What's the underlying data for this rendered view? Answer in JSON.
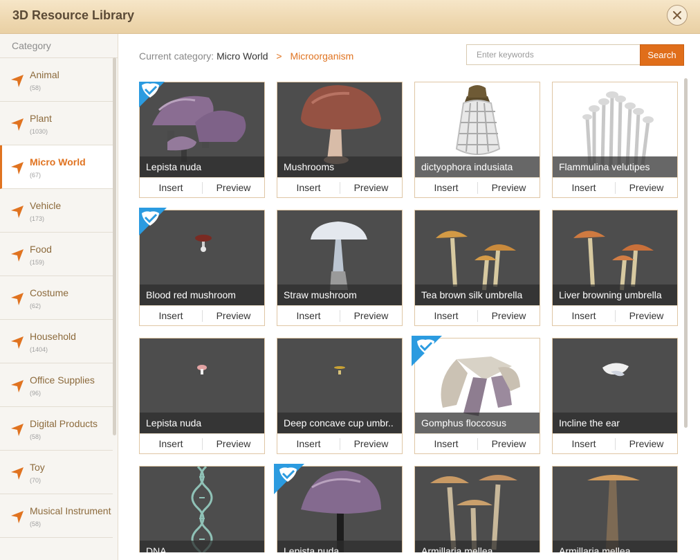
{
  "window": {
    "title": "3D Resource Library"
  },
  "sidebar": {
    "heading": "Category",
    "items": [
      {
        "label": "Animal",
        "count": "(58)",
        "active": false
      },
      {
        "label": "Plant",
        "count": "(1030)",
        "active": false
      },
      {
        "label": "Micro World",
        "count": "(67)",
        "active": true
      },
      {
        "label": "Vehicle",
        "count": "(173)",
        "active": false
      },
      {
        "label": "Food",
        "count": "(159)",
        "active": false
      },
      {
        "label": "Costume",
        "count": "(62)",
        "active": false
      },
      {
        "label": "Household",
        "count": "(1404)",
        "active": false
      },
      {
        "label": "Office Supplies",
        "count": "(96)",
        "active": false
      },
      {
        "label": "Digital Products",
        "count": "(58)",
        "active": false
      },
      {
        "label": "Toy",
        "count": "(70)",
        "active": false
      },
      {
        "label": "Musical Instrument",
        "count": "(58)",
        "active": false
      }
    ]
  },
  "breadcrumb": {
    "prefix": "Current category:",
    "level1": "Micro World",
    "separator": ">",
    "level2": "Microorganism"
  },
  "search": {
    "placeholder": "Enter keywords",
    "value": "",
    "button_label": "Search"
  },
  "card_actions": {
    "insert": "Insert",
    "preview": "Preview"
  },
  "colors": {
    "accent": "#e07320",
    "search_button": "#e06e1a",
    "card_border": "#dfc6a4",
    "thumb_bg": "#4d4d4d",
    "badge": "#2b9be0"
  },
  "cards": [
    {
      "name": "Lepista nuda",
      "badge": true,
      "icon": "purple-mushroom-cluster-icon",
      "light": false
    },
    {
      "name": "Mushrooms",
      "badge": false,
      "icon": "brown-mushroom-icon",
      "light": false
    },
    {
      "name": "dictyophora indusiata",
      "badge": false,
      "icon": "veiled-lady-mushroom-icon",
      "light": true
    },
    {
      "name": "Flammulina velutipes",
      "badge": false,
      "icon": "enoki-mushroom-icon",
      "light": true
    },
    {
      "name": "Blood red mushroom",
      "badge": true,
      "icon": "small-red-mushroom-icon",
      "light": false
    },
    {
      "name": "Straw mushroom",
      "badge": false,
      "icon": "white-mushroom-icon",
      "light": false
    },
    {
      "name": "Tea brown silk umbrella",
      "badge": false,
      "icon": "tan-mushroom-cluster-icon",
      "light": false
    },
    {
      "name": "Liver browning umbrella",
      "badge": false,
      "icon": "orange-mushroom-cluster-icon",
      "light": false
    },
    {
      "name": "Lepista nuda",
      "badge": false,
      "icon": "tiny-pink-mushroom-icon",
      "light": false
    },
    {
      "name": "Deep concave cup umbr..",
      "badge": false,
      "icon": "tiny-yellow-mushroom-icon",
      "light": false
    },
    {
      "name": "Gomphus floccosus",
      "badge": true,
      "icon": "gomphus-mushroom-icon",
      "light": true
    },
    {
      "name": "Incline the ear",
      "badge": false,
      "icon": "white-ear-fungus-icon",
      "light": false
    },
    {
      "name": "DNA",
      "badge": false,
      "icon": "dna-helix-icon",
      "light": false
    },
    {
      "name": "Lepista nuda",
      "badge": true,
      "icon": "purple-mushroom-icon",
      "light": false
    },
    {
      "name": "Armillaria mellea",
      "badge": false,
      "icon": "honey-mushroom-cluster-icon",
      "light": false
    },
    {
      "name": "Armillaria mellea",
      "badge": false,
      "icon": "honey-mushroom-icon",
      "light": false
    }
  ]
}
